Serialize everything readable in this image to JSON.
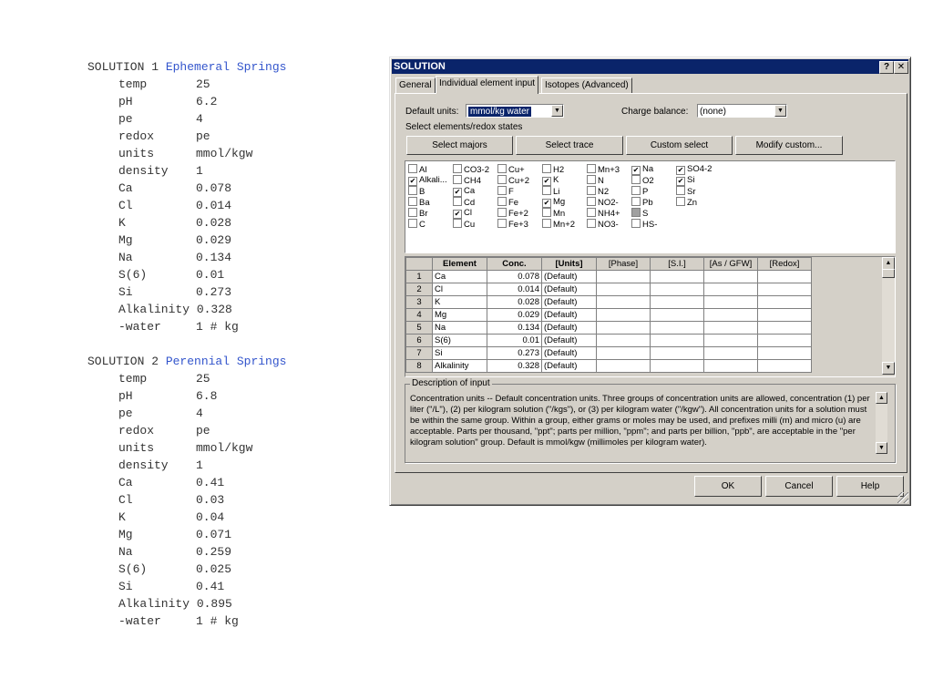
{
  "listing": [
    {
      "keyword": "SOLUTION 1",
      "name": "Ephemeral Springs",
      "rows": [
        {
          "k": "temp",
          "v": "25"
        },
        {
          "k": "pH",
          "v": "6.2"
        },
        {
          "k": "pe",
          "v": "4"
        },
        {
          "k": "redox",
          "v": "pe"
        },
        {
          "k": "units",
          "v": "mmol/kgw"
        },
        {
          "k": "density",
          "v": "1"
        },
        {
          "k": "Ca",
          "v": "0.078"
        },
        {
          "k": "Cl",
          "v": "0.014"
        },
        {
          "k": "K",
          "v": "0.028"
        },
        {
          "k": "Mg",
          "v": "0.029"
        },
        {
          "k": "Na",
          "v": "0.134"
        },
        {
          "k": "S(6)",
          "v": "0.01"
        },
        {
          "k": "Si",
          "v": "0.273"
        },
        {
          "k": "Alkalinity 0.328",
          "v": ""
        },
        {
          "k": "-water",
          "v": "1 # kg"
        }
      ]
    },
    {
      "keyword": "SOLUTION 2",
      "name": "Perennial Springs",
      "rows": [
        {
          "k": "temp",
          "v": "25"
        },
        {
          "k": "pH",
          "v": "6.8"
        },
        {
          "k": "pe",
          "v": "4"
        },
        {
          "k": "redox",
          "v": "pe"
        },
        {
          "k": "units",
          "v": "mmol/kgw"
        },
        {
          "k": "density",
          "v": "1"
        },
        {
          "k": "Ca",
          "v": "0.41"
        },
        {
          "k": "Cl",
          "v": "0.03"
        },
        {
          "k": "K",
          "v": "0.04"
        },
        {
          "k": "Mg",
          "v": "0.071"
        },
        {
          "k": "Na",
          "v": "0.259"
        },
        {
          "k": "S(6)",
          "v": "0.025"
        },
        {
          "k": "Si",
          "v": "0.41"
        },
        {
          "k": "Alkalinity 0.895",
          "v": ""
        },
        {
          "k": "-water",
          "v": "1 # kg"
        }
      ]
    }
  ],
  "dialog": {
    "title": "SOLUTION",
    "help_glyph": "?",
    "close_glyph": "✕",
    "tabs": [
      "General",
      "Individual element input",
      "Isotopes (Advanced)"
    ],
    "default_units_label": "Default units:",
    "default_units_value": "mmol/kg water",
    "charge_balance_label": "Charge balance:",
    "charge_balance_value": "(none)",
    "select_label": "Select elements/redox states",
    "buttons": {
      "select_majors": "Select majors",
      "select_trace": "Select trace",
      "custom_select": "Custom select",
      "modify_custom": "Modify custom..."
    },
    "checkboxes": [
      [
        {
          "t": "Al",
          "s": 0
        },
        {
          "t": "Alkali...",
          "s": 1
        },
        {
          "t": "B",
          "s": 0
        },
        {
          "t": "Ba",
          "s": 0
        },
        {
          "t": "Br",
          "s": 0
        },
        {
          "t": "C",
          "s": 0
        }
      ],
      [
        {
          "t": "CO3-2",
          "s": 0
        },
        {
          "t": "CH4",
          "s": 0
        },
        {
          "t": "Ca",
          "s": 1
        },
        {
          "t": "Cd",
          "s": 0
        },
        {
          "t": "Cl",
          "s": 1
        },
        {
          "t": "Cu",
          "s": 0
        }
      ],
      [
        {
          "t": "Cu+",
          "s": 0
        },
        {
          "t": "Cu+2",
          "s": 0
        },
        {
          "t": "F",
          "s": 0
        },
        {
          "t": "Fe",
          "s": 0
        },
        {
          "t": "Fe+2",
          "s": 0
        },
        {
          "t": "Fe+3",
          "s": 0
        }
      ],
      [
        {
          "t": "H2",
          "s": 0
        },
        {
          "t": "K",
          "s": 1
        },
        {
          "t": "Li",
          "s": 0
        },
        {
          "t": "Mg",
          "s": 1
        },
        {
          "t": "Mn",
          "s": 0
        },
        {
          "t": "Mn+2",
          "s": 0
        }
      ],
      [
        {
          "t": "Mn+3",
          "s": 0
        },
        {
          "t": "N",
          "s": 0
        },
        {
          "t": "N2",
          "s": 0
        },
        {
          "t": "NO2-",
          "s": 0
        },
        {
          "t": "NH4+",
          "s": 0
        },
        {
          "t": "NO3-",
          "s": 0
        }
      ],
      [
        {
          "t": "Na",
          "s": 1
        },
        {
          "t": "O2",
          "s": 0
        },
        {
          "t": "P",
          "s": 0
        },
        {
          "t": "Pb",
          "s": 0
        },
        {
          "t": "S",
          "s": 2
        },
        {
          "t": "HS-",
          "s": 0
        }
      ],
      [
        {
          "t": "SO4-2",
          "s": 1
        },
        {
          "t": "Si",
          "s": 1
        },
        {
          "t": "Sr",
          "s": 0
        },
        {
          "t": "Zn",
          "s": 0
        }
      ]
    ],
    "grid": {
      "headers": [
        "Element",
        "Conc.",
        "[Units]",
        "[Phase]",
        "[S.I.]",
        "[As / GFW]",
        "[Redox]"
      ],
      "rows": [
        {
          "n": "1",
          "el": "Ca",
          "c": "0.078",
          "u": "(Default)"
        },
        {
          "n": "2",
          "el": "Cl",
          "c": "0.014",
          "u": "(Default)"
        },
        {
          "n": "3",
          "el": "K",
          "c": "0.028",
          "u": "(Default)"
        },
        {
          "n": "4",
          "el": "Mg",
          "c": "0.029",
          "u": "(Default)"
        },
        {
          "n": "5",
          "el": "Na",
          "c": "0.134",
          "u": "(Default)"
        },
        {
          "n": "6",
          "el": "S(6)",
          "c": "0.01",
          "u": "(Default)"
        },
        {
          "n": "7",
          "el": "Si",
          "c": "0.273",
          "u": "(Default)"
        },
        {
          "n": "8",
          "el": "Alkalinity",
          "c": "0.328",
          "u": "(Default)"
        }
      ]
    },
    "description_label": "Description of input",
    "description_text": "Concentration units -- Default concentration units. Three groups of concentration units are allowed, concentration (1) per liter (\"/L\"), (2) per kilogram solution (\"/kgs\"), or (3) per kilogram water (\"/kgw\"). All concentration units for a solution must be within the same group. Within a group, either grams or moles may be used, and prefixes milli (m) and micro (u) are acceptable. Parts per thousand, \"ppt\"; parts per million, \"ppm\"; and parts per billion, \"ppb\", are acceptable in the \"per kilogram solution\" group. Default is mmol/kgw (millimoles per kilogram water).",
    "footer": {
      "ok": "OK",
      "cancel": "Cancel",
      "help": "Help"
    },
    "colors": {
      "titlebar": "#0a246a",
      "face": "#d4d0c8",
      "listing_name": "#3355cc"
    }
  }
}
